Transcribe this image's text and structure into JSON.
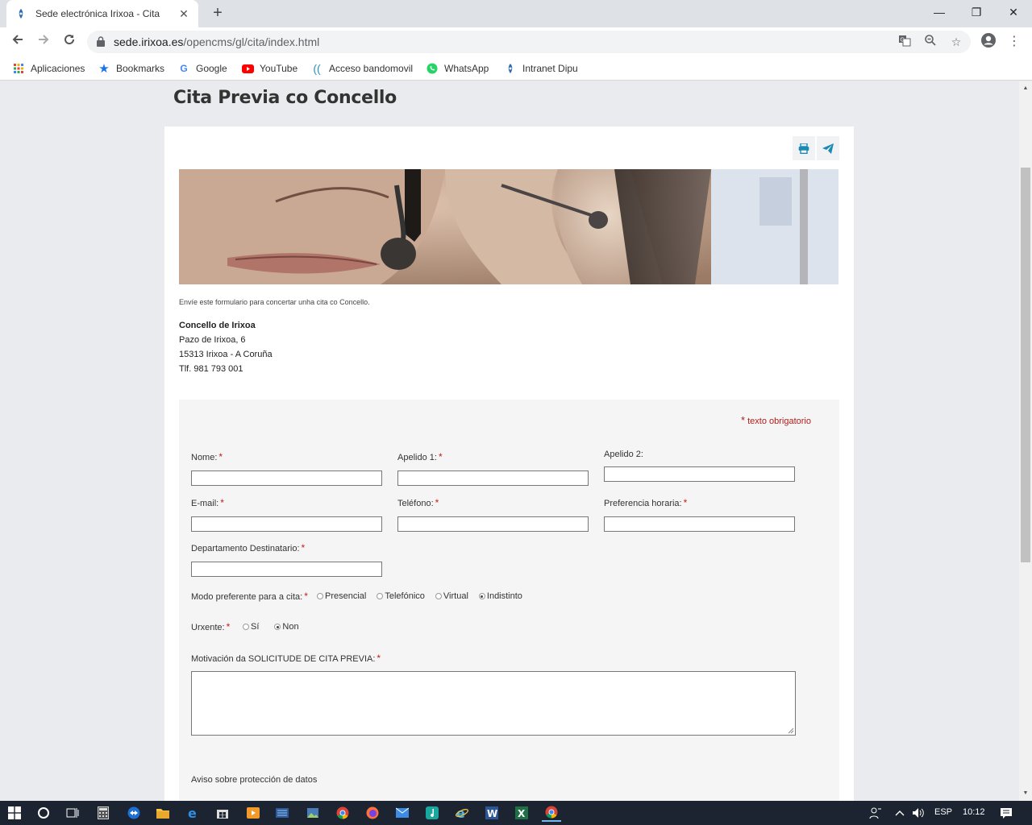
{
  "browser": {
    "tab_title": "Sede electrónica Irixoa - Cita",
    "url_host": "sede.irixoa.es",
    "url_path": "/opencms/gl/cita/index.html",
    "bookmarks": [
      {
        "label": "Aplicaciones",
        "icon": "apps-grid-icon"
      },
      {
        "label": "Bookmarks",
        "icon": "star-icon"
      },
      {
        "label": "Google",
        "icon": "google-icon"
      },
      {
        "label": "YouTube",
        "icon": "youtube-icon"
      },
      {
        "label": "Acceso bandomovil",
        "icon": "signal-icon"
      },
      {
        "label": "WhatsApp",
        "icon": "whatsapp-icon"
      },
      {
        "label": "Intranet Dipu",
        "icon": "intranet-icon"
      }
    ]
  },
  "page": {
    "title": "Cita Previa co Concello",
    "intro": "Envíe este formulario para concertar unha cita co Concello.",
    "address": {
      "org": "Concello de Irixoa",
      "street": "Pazo de Irixoa, 6",
      "city": "15313 Irixoa - A Coruña",
      "phone": "Tlf. 981 793 001"
    }
  },
  "form": {
    "required_note": "texto obrigatorio",
    "required_mark": "*",
    "fields": {
      "nome": "Nome:",
      "apelido1": "Apelido 1:",
      "apelido2": "Apelido 2:",
      "email": "E-mail:",
      "telefono": "Teléfono:",
      "preferencia": "Preferencia horaria:",
      "departamento": "Departamento Destinatario:",
      "modo": "Modo preferente para a cita:",
      "urxente": "Urxente:",
      "motivacion": "Motivación da SOLICITUDE DE CITA PREVIA:"
    },
    "modo_options": [
      {
        "label": "Presencial",
        "checked": false
      },
      {
        "label": "Telefónico",
        "checked": false
      },
      {
        "label": "Virtual",
        "checked": false
      },
      {
        "label": "Indistinto",
        "checked": true
      }
    ],
    "urxente_options": [
      {
        "label": "Sí",
        "checked": false
      },
      {
        "label": "Non",
        "checked": true
      }
    ],
    "privacy_title": "Aviso sobre protección de datos"
  },
  "taskbar": {
    "lang": "ESP",
    "time": "10:12"
  },
  "colors": {
    "accent": "#1a8ab4",
    "required": "#c0201c"
  }
}
